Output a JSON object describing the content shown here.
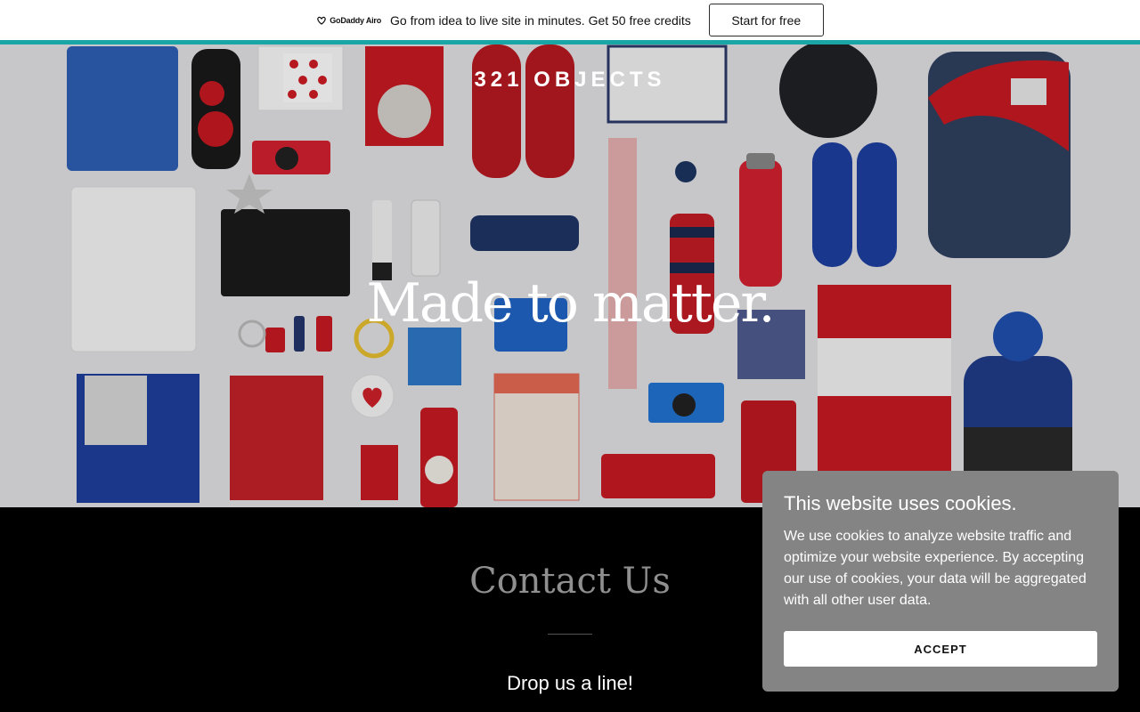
{
  "promo": {
    "logo_text": "GoDaddy Airo",
    "message": "Go from idea to live site in minutes. Get 50 free credits",
    "button_label": "Start for free"
  },
  "hero": {
    "brand": "321 OBJECTS",
    "headline": "Made to matter."
  },
  "contact": {
    "title": "Contact Us",
    "subtitle": "Drop us a line!"
  },
  "cookie_banner": {
    "title": "This website uses cookies.",
    "body": "We use cookies to analyze website traffic and optimize your website experience. By accepting our use of cookies, your data will be aggregated with all other user data.",
    "accept_label": "ACCEPT"
  },
  "colors": {
    "accent": "#1aa6a6",
    "cookie_bg": "#848484",
    "contact_bg": "#000000"
  }
}
